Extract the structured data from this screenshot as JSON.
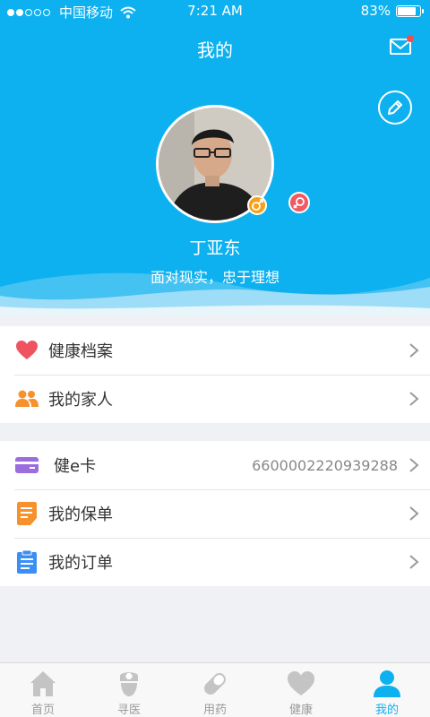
{
  "status_bar": {
    "carrier": "中国移动",
    "time": "7:21 AM",
    "battery": "83%",
    "battery_level": 0.83,
    "signal_bars": 2
  },
  "header": {
    "title": "我的",
    "mail_icon": "mail-icon",
    "has_unread_badge": true,
    "edit_icon": "pencil-icon"
  },
  "profile": {
    "name": "丁亚东",
    "motto": "面对现实，忠于理想",
    "gender_male_icon": "male-symbol-icon",
    "gender_female_icon": "female-symbol-icon"
  },
  "menu_group_1": [
    {
      "label": "健康档案",
      "icon": "heart-icon",
      "color": "#ef5360"
    },
    {
      "label": "我的家人",
      "icon": "family-icon",
      "color": "#f6922d"
    }
  ],
  "menu_group_2": [
    {
      "label": "健e卡",
      "value": "6600002220939288",
      "icon": "card-icon",
      "color": "#9b6ee0"
    },
    {
      "label": "我的保单",
      "icon": "document-icon",
      "color": "#f6922d"
    },
    {
      "label": "我的订单",
      "icon": "clipboard-icon",
      "color": "#3a8ef5"
    }
  ],
  "tabbar": [
    {
      "label": "首页",
      "icon": "home-icon",
      "active": false
    },
    {
      "label": "寻医",
      "icon": "nurse-icon",
      "active": false
    },
    {
      "label": "用药",
      "icon": "pill-icon",
      "active": false
    },
    {
      "label": "健康",
      "icon": "heart-icon",
      "active": false
    },
    {
      "label": "我的",
      "icon": "person-icon",
      "active": true
    }
  ],
  "colors": {
    "primary": "#0db1ef",
    "tab_inactive": "#c4c4c4",
    "badge": "#f04e4e"
  }
}
